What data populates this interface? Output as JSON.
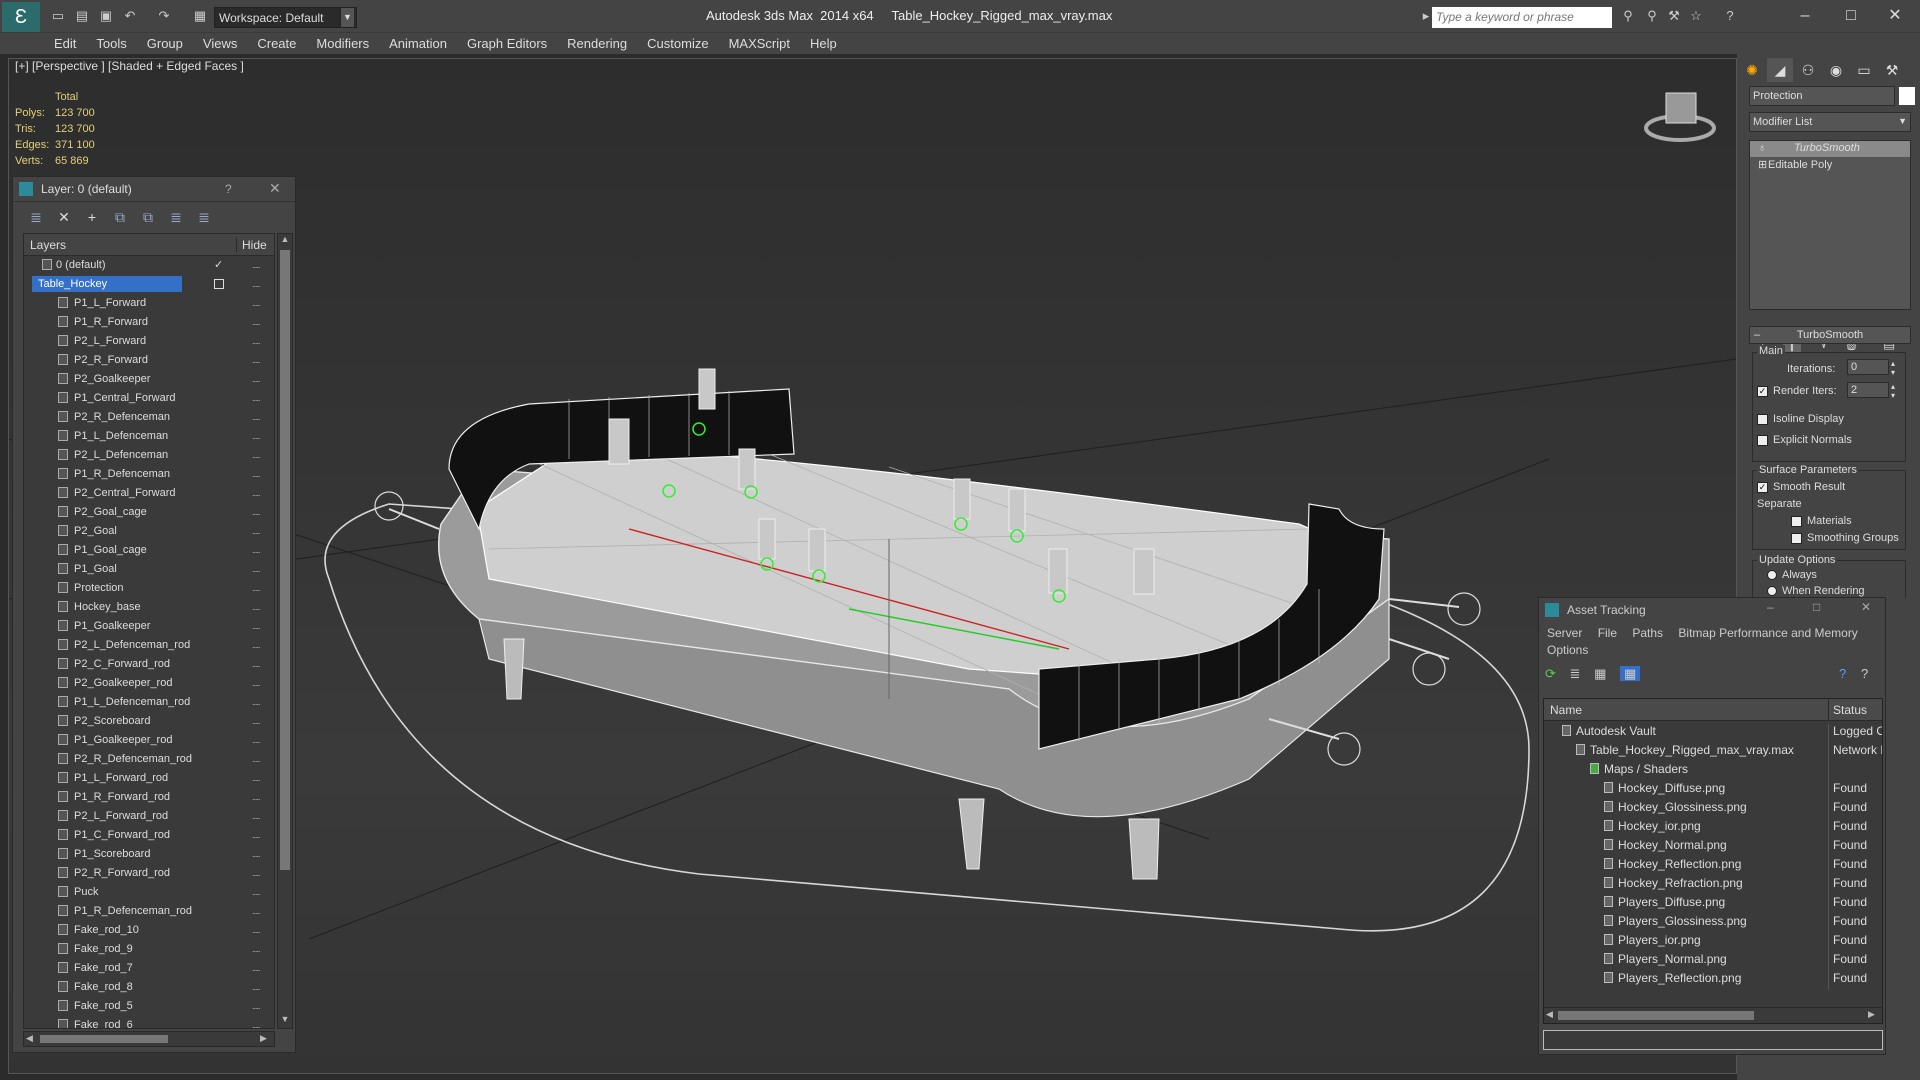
{
  "app": {
    "title": "Autodesk 3ds Max  2014 x64     Table_Hockey_Rigged_max_vray.max",
    "workspace": "Workspace: Default",
    "search_placeholder": "Type a keyword or phrase"
  },
  "menu": [
    "Edit",
    "Tools",
    "Group",
    "Views",
    "Create",
    "Modifiers",
    "Animation",
    "Graph Editors",
    "Rendering",
    "Customize",
    "MAXScript",
    "Help"
  ],
  "viewport": {
    "label": "[+] [Perspective ] [Shaded + Edged Faces ]",
    "stats_header": "Total",
    "stats": [
      {
        "label": "Polys:",
        "value": "123 700"
      },
      {
        "label": "Tris:",
        "value": "123 700"
      },
      {
        "label": "Edges:",
        "value": "371 100"
      },
      {
        "label": "Verts:",
        "value": "65 869"
      }
    ]
  },
  "layer_panel": {
    "title": "Layer: 0 (default)",
    "help": "?",
    "col_layers": "Layers",
    "col_hide": "Hide",
    "rows": [
      "0 (default)",
      "Table_Hockey",
      "P1_L_Forward",
      "P1_R_Forward",
      "P2_L_Forward",
      "P2_R_Forward",
      "P2_Goalkeeper",
      "P1_Central_Forward",
      "P2_R_Defenceman",
      "P1_L_Defenceman",
      "P2_L_Defenceman",
      "P1_R_Defenceman",
      "P2_Central_Forward",
      "P2_Goal_cage",
      "P2_Goal",
      "P1_Goal_cage",
      "P1_Goal",
      "Protection",
      "Hockey_base",
      "P1_Goalkeeper",
      "P2_L_Defenceman_rod",
      "P2_C_Forward_rod",
      "P2_Goalkeeper_rod",
      "P1_L_Defenceman_rod",
      "P2_Scoreboard",
      "P1_Goalkeeper_rod",
      "P2_R_Defenceman_rod",
      "P1_L_Forward_rod",
      "P1_R_Forward_rod",
      "P2_L_Forward_rod",
      "P1_C_Forward_rod",
      "P1_Scoreboard",
      "P2_R_Forward_rod",
      "Puck",
      "P1_R_Defenceman_rod",
      "Fake_rod_10",
      "Fake_rod_9",
      "Fake_rod_7",
      "Fake_rod_8",
      "Fake_rod_5",
      "Fake_rod_6"
    ],
    "hide_marker": "....."
  },
  "command_panel": {
    "object_name": "Protection",
    "modifier_list": "Modifier List",
    "stack": [
      "TurboSmooth",
      "Editable Poly"
    ],
    "rollout_title": "TurboSmooth",
    "main_label": "Main",
    "iterations_label": "Iterations:",
    "iterations_value": "0",
    "render_iters_label": "Render Iters:",
    "render_iters_value": "2",
    "isoline": "Isoline Display",
    "explicit": "Explicit Normals",
    "surface_params": "Surface Parameters",
    "smooth_result": "Smooth Result",
    "separate": "Separate",
    "materials": "Materials",
    "smoothing_groups": "Smoothing Groups",
    "update_options": "Update Options",
    "always": "Always",
    "when_rendering": "When Rendering"
  },
  "asset_tracking": {
    "title": "Asset Tracking",
    "menu": [
      "Server",
      "File",
      "Paths",
      "Bitmap Performance and Memory"
    ],
    "menu2": "Options",
    "col_name": "Name",
    "col_status": "Status",
    "rows": [
      {
        "name": "Autodesk Vault",
        "status": "Logged Ou",
        "indent": 1
      },
      {
        "name": "Table_Hockey_Rigged_max_vray.max",
        "status": "Network Pa",
        "indent": 2
      },
      {
        "name": "Maps / Shaders",
        "status": "",
        "indent": 3
      },
      {
        "name": "Hockey_Diffuse.png",
        "status": "Found",
        "indent": 4
      },
      {
        "name": "Hockey_Glossiness.png",
        "status": "Found",
        "indent": 4
      },
      {
        "name": "Hockey_ior.png",
        "status": "Found",
        "indent": 4
      },
      {
        "name": "Hockey_Normal.png",
        "status": "Found",
        "indent": 4
      },
      {
        "name": "Hockey_Reflection.png",
        "status": "Found",
        "indent": 4
      },
      {
        "name": "Hockey_Refraction.png",
        "status": "Found",
        "indent": 4
      },
      {
        "name": "Players_Diffuse.png",
        "status": "Found",
        "indent": 4
      },
      {
        "name": "Players_Glossiness.png",
        "status": "Found",
        "indent": 4
      },
      {
        "name": "Players_ior.png",
        "status": "Found",
        "indent": 4
      },
      {
        "name": "Players_Normal.png",
        "status": "Found",
        "indent": 4
      },
      {
        "name": "Players_Reflection.png",
        "status": "Found",
        "indent": 4
      }
    ]
  }
}
